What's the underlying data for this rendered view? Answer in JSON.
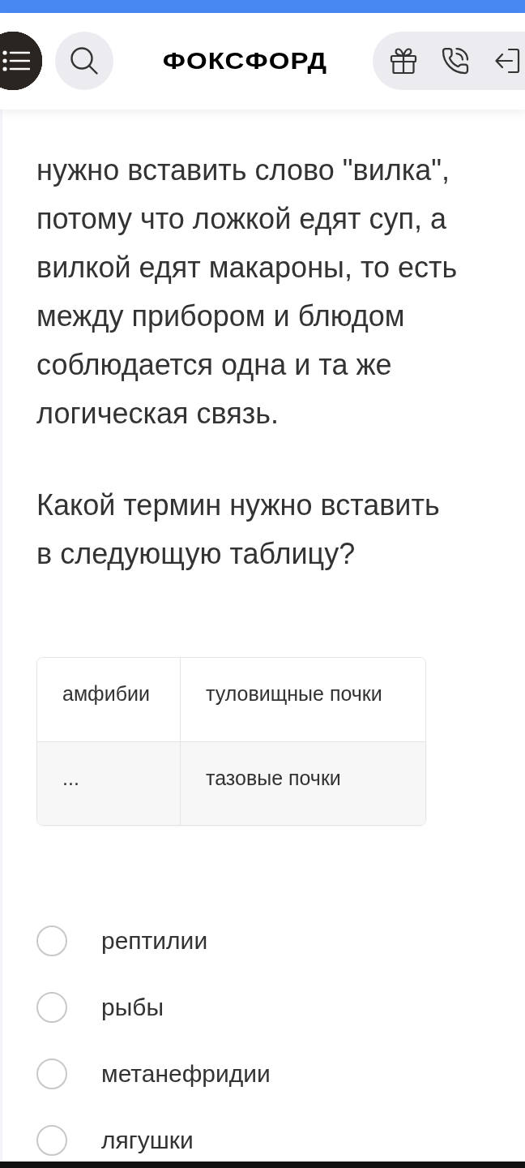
{
  "header": {
    "logo": "ФОКСФОРД"
  },
  "explanation": "нужно вставить слово \"вилка\", потому что ложкой едят суп, а вилкой едят макароны, то есть между прибором и блюдом соблюдается одна и та же логическая связь.",
  "question": "Какой термин нужно вставить в следующую таблицу?",
  "table": {
    "rows": [
      [
        "амфибии",
        "туловищные почки"
      ],
      [
        "...",
        "тазовые почки"
      ]
    ]
  },
  "options": [
    {
      "label": "рептилии",
      "selected": false
    },
    {
      "label": "рыбы",
      "selected": false
    },
    {
      "label": "метанефридии",
      "selected": false
    },
    {
      "label": "лягушки",
      "selected": false
    }
  ]
}
